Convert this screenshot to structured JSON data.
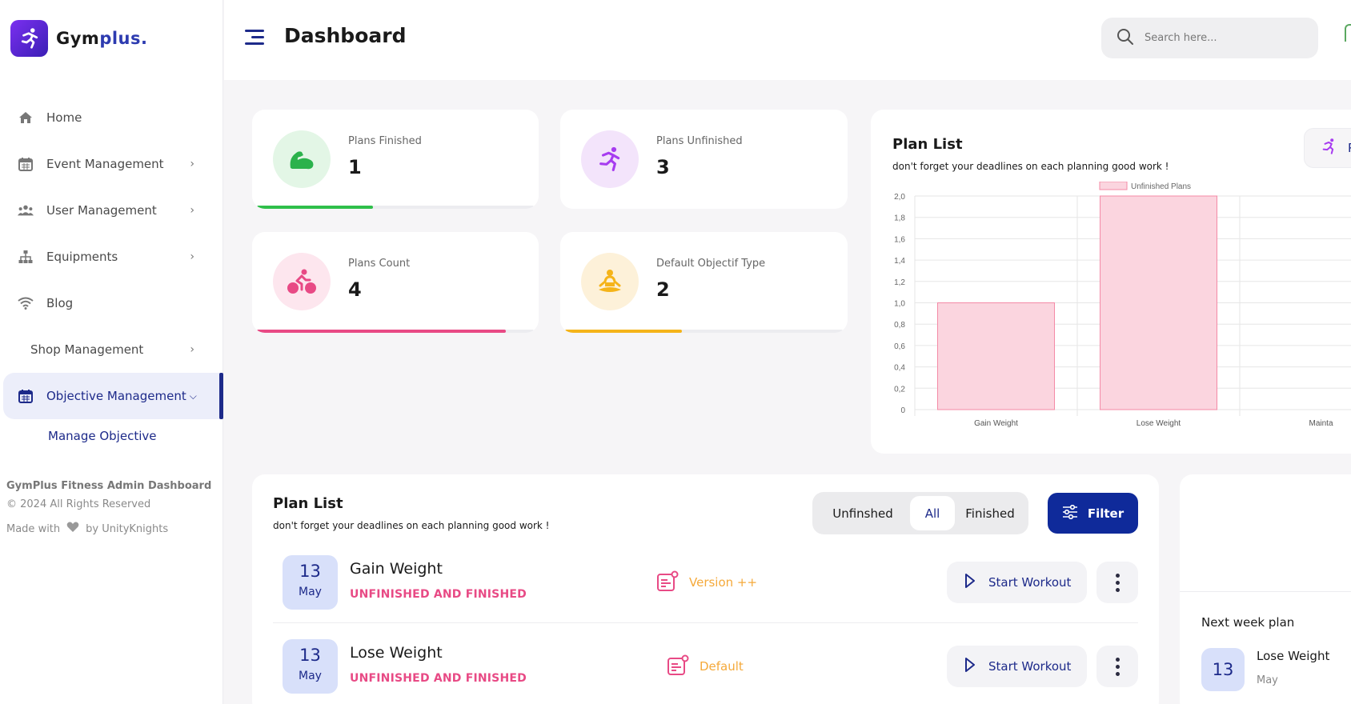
{
  "brand": {
    "name_prefix": "Gym",
    "name_suffix": "plus."
  },
  "header": {
    "title": "Dashboard",
    "search_placeholder": "Search here..."
  },
  "sidebar": {
    "items": [
      {
        "label": "Home"
      },
      {
        "label": "Event Management"
      },
      {
        "label": "User Management"
      },
      {
        "label": "Equipments"
      },
      {
        "label": "Blog"
      },
      {
        "label": "Shop Management"
      },
      {
        "label": "Objective Management"
      }
    ],
    "sub_item": "Manage Objective",
    "footer_title": "GymPlus Fitness Admin Dashboard",
    "footer_copy": "© 2024 All Rights Reserved",
    "footer_made_with": "Made with",
    "footer_by": "by UnityKnights"
  },
  "stats": [
    {
      "label": "Plans Finished",
      "value": "1",
      "progress": 0.42,
      "color": "#2fbf4a"
    },
    {
      "label": "Plans Unfinished",
      "value": "3",
      "progress": 0,
      "color": "#a73cf0"
    },
    {
      "label": "Plans Count",
      "value": "4",
      "progress": 0.9,
      "color": "#e84a85"
    },
    {
      "label": "Default Objectif Type",
      "value": "2",
      "progress": 0.42,
      "color": "#f5b41a"
    }
  ],
  "chart_card": {
    "title": "Plan List",
    "subtitle": "don't forget your deadlines on each planning good work !",
    "button_label": "P"
  },
  "chart_data": {
    "type": "bar",
    "categories": [
      "Gain Weight",
      "Lose Weight",
      "Mainta"
    ],
    "series": [
      {
        "name": "Unfinished Plans",
        "values": [
          1,
          2,
          null
        ]
      }
    ],
    "ylim": [
      0,
      2
    ],
    "yticks": [
      "0",
      "0,2",
      "0,4",
      "0,6",
      "0,8",
      "1,0",
      "1,2",
      "1,4",
      "1,6",
      "1,8",
      "2,0"
    ],
    "legend": "top",
    "grid": true,
    "bar_color": "#fbd5df",
    "bar_border": "#f48aa6"
  },
  "plan_list": {
    "title": "Plan List",
    "subtitle": "don't forget your deadlines on each planning good work !",
    "tabs": [
      "Unfinshed",
      "All",
      "Finished"
    ],
    "filter_label": "Filter",
    "rows": [
      {
        "day": "13",
        "month": "May",
        "name": "Gain Weight",
        "status": "UNFINISHED AND FINISHED",
        "type": "Version ++",
        "action": "Start Workout"
      },
      {
        "day": "13",
        "month": "May",
        "name": "Lose Weight",
        "status": "UNFINISHED AND FINISHED",
        "type": "Default",
        "action": "Start Workout"
      }
    ]
  },
  "next_week": {
    "title": "Next week plan",
    "day": "13",
    "name": "Lose Weight",
    "month": "May"
  }
}
